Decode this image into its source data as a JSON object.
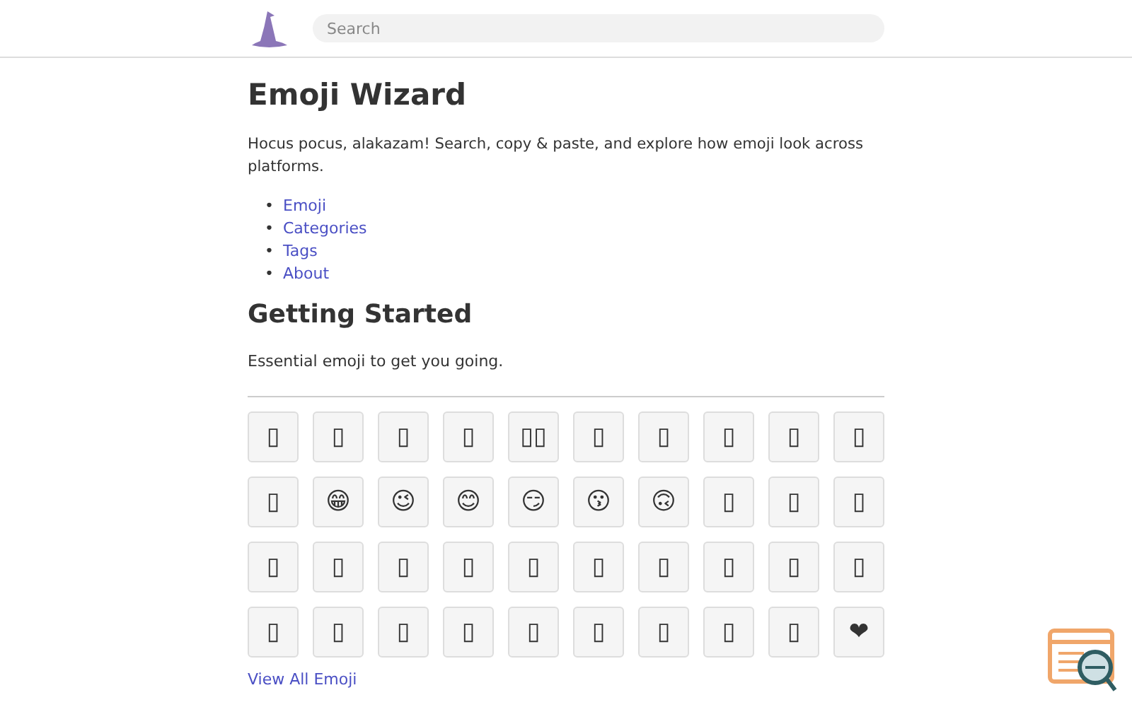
{
  "header": {
    "search": {
      "placeholder": "Search"
    }
  },
  "title": "Emoji Wizard",
  "intro": "Hocus pocus, alakazam! Search, copy & paste, and explore how emoji look across platforms.",
  "nav_links": [
    {
      "bullet": "•",
      "label": "Emoji"
    },
    {
      "bullet": "•",
      "label": "Categories"
    },
    {
      "bullet": "•",
      "label": "Tags"
    },
    {
      "bullet": "•",
      "label": "About"
    }
  ],
  "section": {
    "title": "Getting Started",
    "description": "Essential emoji to get you going.",
    "emoji": [
      "▯",
      "▯",
      "▯",
      "▯",
      "▯▯",
      "▯",
      "▯",
      "▯",
      "▯",
      "▯",
      "▯",
      "😁",
      "😉",
      "😊",
      "😏",
      "😗",
      "🙃",
      "▯",
      "▯",
      "▯",
      "▯",
      "▯",
      "▯",
      "▯",
      "▯",
      "▯",
      "▯",
      "▯",
      "▯",
      "▯",
      "▯",
      "▯",
      "▯",
      "▯",
      "▯",
      "▯",
      "▯",
      "▯",
      "▯",
      "❤"
    ],
    "view_all": "View All Emoji"
  }
}
